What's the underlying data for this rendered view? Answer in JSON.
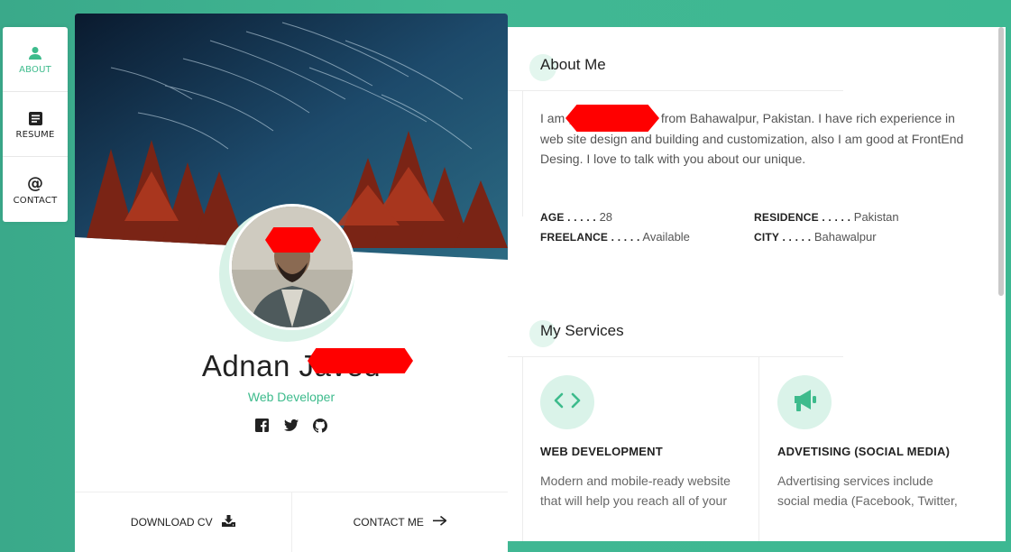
{
  "nav": {
    "items": [
      {
        "label": "ABOUT",
        "icon": "user-icon",
        "active": true
      },
      {
        "label": "RESUME",
        "icon": "document-icon",
        "active": false
      },
      {
        "label": "CONTACT",
        "icon": "at-icon",
        "active": false
      }
    ]
  },
  "profile": {
    "name": "Adnan Javed",
    "role": "Web Developer",
    "socials": [
      "facebook-icon",
      "twitter-icon",
      "github-icon"
    ],
    "download_label": "DOWNLOAD CV",
    "contact_label": "CONTACT ME"
  },
  "about": {
    "title": "About Me",
    "text": "I am , web developer from Bahawalpur, Pakistan. I have rich experience in web site design and building and customization, also I am good at FrontEnd Desing. I love to talk with you about our unique.",
    "info": [
      {
        "key": "AGE . . . . .",
        "value": "28"
      },
      {
        "key": "RESIDENCE . . . . .",
        "value": "Pakistan"
      },
      {
        "key": "FREELANCE . . . . .",
        "value": "Available"
      },
      {
        "key": "CITY . . . . .",
        "value": "Bahawalpur"
      }
    ]
  },
  "services": {
    "title": "My Services",
    "items": [
      {
        "icon": "code-icon",
        "title": "WEB DEVELOPMENT",
        "desc": "Modern and mobile-ready website that will help you reach all of your marketing"
      },
      {
        "icon": "megaphone-icon",
        "title": "ADVETISING (SOCIAL MEDIA)",
        "desc": "Advertising services include social media (Facebook, Twitter, Instagram)"
      }
    ]
  },
  "colors": {
    "accent": "#3dbb8c",
    "background": "#41b793"
  }
}
